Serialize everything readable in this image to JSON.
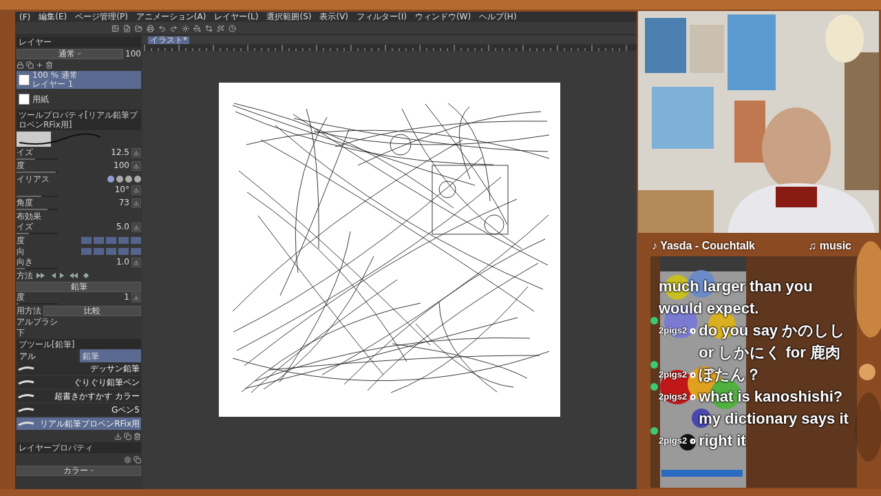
{
  "menu": [
    {
      "label": "(F)"
    },
    {
      "label": "編集(E)"
    },
    {
      "label": "ページ管理(P)"
    },
    {
      "label": "アニメーション(A)"
    },
    {
      "label": "レイヤー(L)"
    },
    {
      "label": "選択範囲(S)"
    },
    {
      "label": "表示(V)"
    },
    {
      "label": "フィルター(I)"
    },
    {
      "label": "ウィンドウ(W)"
    },
    {
      "label": "ヘルプ(H)"
    }
  ],
  "document_tab": {
    "label": "イラスト*"
  },
  "layer_panel": {
    "title": "レイヤー",
    "blend_mode": "通常",
    "opacity": "100",
    "layers": [
      {
        "mode": "100 % 通常",
        "name": "レイヤー 1",
        "selected": true
      },
      {
        "name": "用紙",
        "selected": false
      }
    ]
  },
  "tool_property": {
    "title": "ツールプロパティ[リアル鉛筆プロペンRFix用]",
    "rows": [
      {
        "kind": "slider",
        "label": "イズ",
        "value": "12.5",
        "level": 0.45
      },
      {
        "kind": "slider",
        "label": "度",
        "value": "100",
        "level": 0.95
      },
      {
        "kind": "dots",
        "label": "イリアス",
        "options": [
          {
            "selected": true
          },
          {
            "selected": false
          },
          {
            "selected": false
          },
          {
            "selected": false
          }
        ]
      },
      {
        "kind": "slider",
        "value": "10°",
        "level": 0.6
      },
      {
        "kind": "slider",
        "label": "角度",
        "value": "73",
        "level": 0.75
      },
      {
        "kind": "section",
        "label": "布効果"
      },
      {
        "kind": "slider",
        "label": "イズ",
        "value": "5.0",
        "level": 0.3
      },
      {
        "kind": "blocks",
        "label": "度"
      },
      {
        "kind": "blocks",
        "label": "向"
      },
      {
        "kind": "slider",
        "label": "向き",
        "value": "1.0",
        "level": 0.2
      },
      {
        "kind": "playback",
        "label": "方法"
      },
      {
        "kind": "select",
        "value": "鉛筆"
      },
      {
        "kind": "slider",
        "label": "度",
        "value": "1",
        "level": 0.05
      },
      {
        "kind": "select",
        "label": "用方法",
        "value": "比較"
      },
      {
        "kind": "section",
        "label": "アルブラシ"
      },
      {
        "kind": "section",
        "label": "下"
      }
    ]
  },
  "sub_tool": {
    "title": "ブツール[鉛筆]",
    "tabs": [
      {
        "label": "アル",
        "selected": false
      },
      {
        "label": "鉛筆",
        "selected": true
      }
    ],
    "brushes": [
      {
        "name": "デッサン鉛筆",
        "selected": false
      },
      {
        "name": "ぐりぐり鉛筆ペン",
        "selected": false
      },
      {
        "name": "超書きかすかす カラー",
        "selected": false
      },
      {
        "name": "Gペン5",
        "selected": false
      },
      {
        "name": "リアル鉛筆プロペンRFix用",
        "selected": true
      }
    ]
  },
  "layer_property": {
    "title": "レイヤープロパティ",
    "color_mode": "カラー"
  },
  "now_playing": {
    "track": "♪ Yasda - Couchtalk",
    "label": "♫ music"
  },
  "chat": [
    {
      "text": "much larger than you would expect."
    },
    {
      "user": "2pigs2",
      "text": "do you say かのしし or しかにく for 鹿肉"
    },
    {
      "user": "2pigs2",
      "text": "ぼたん？"
    },
    {
      "user": "2pigs2",
      "text": "what is kanoshishi? my dictionary says it"
    },
    {
      "user": "2pigs2",
      "text": "right it"
    }
  ]
}
